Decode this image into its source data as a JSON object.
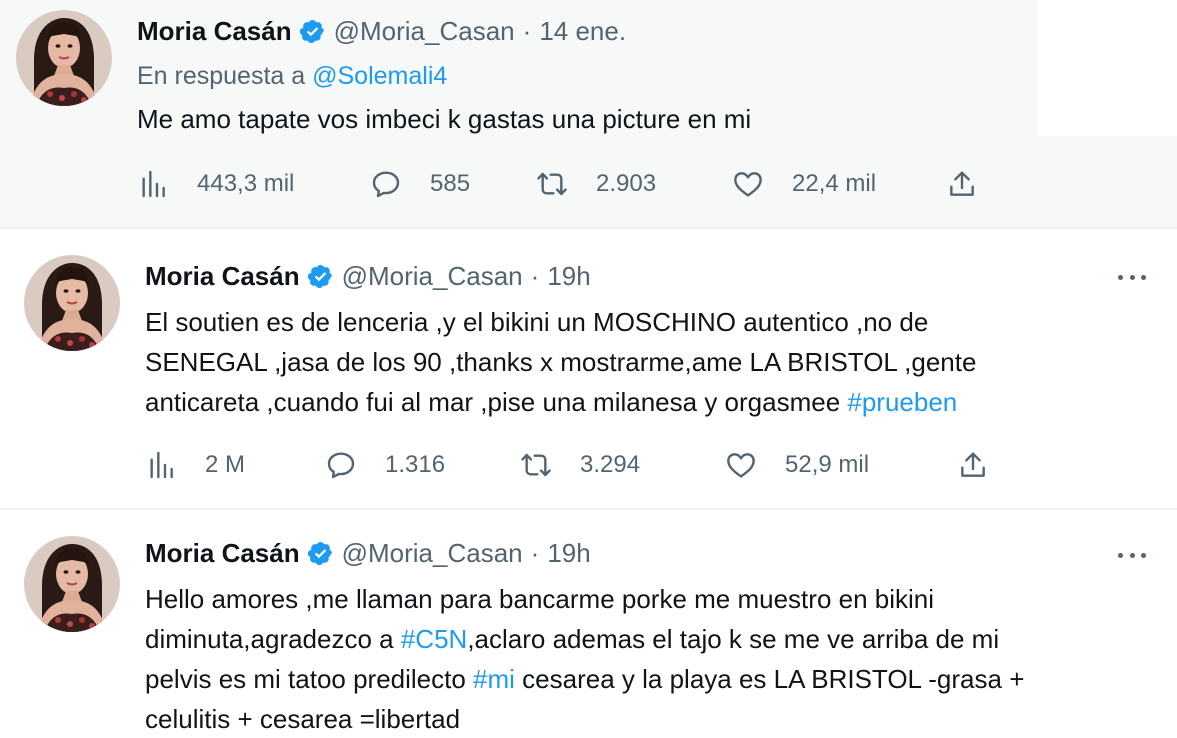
{
  "colors": {
    "accent": "#1d9bf0",
    "muted": "#536471",
    "text": "#0f1419"
  },
  "tweets": [
    {
      "name": "Moria Casán",
      "handle": "@Moria_Casan",
      "dot": "·",
      "time": "14 ene.",
      "reply_prefix": "En respuesta a",
      "reply_to": "@Solemali4",
      "lines": [
        [
          "Me amo tapate vos imbeci  k gastas una picture en mi"
        ]
      ],
      "stats": {
        "views": "443,3 mil",
        "replies": "585",
        "retweets": "2.903",
        "likes": "22,4 mil"
      }
    },
    {
      "name": "Moria Casán",
      "handle": "@Moria_Casan",
      "dot": "·",
      "time": "19h",
      "lines": [
        [
          "El soutien es de lenceria ,y el bikini un MOSCHINO autentico ,no de"
        ],
        [
          "SENEGAL ,jasa de los 90 ,thanks x mostrarme,ame LA BRISTOL ,gente"
        ],
        [
          "anticareta ,cuando fui al mar ,pise una milanesa y orgasmee ",
          "#prueben"
        ]
      ],
      "stats": {
        "views": "2 M",
        "replies": "1.316",
        "retweets": "3.294",
        "likes": "52,9 mil"
      }
    },
    {
      "name": "Moria Casán",
      "handle": "@Moria_Casan",
      "dot": "·",
      "time": "19h",
      "lines": [
        [
          "Hello amores ,me llaman para bancarme porke me muestro en bikini"
        ],
        [
          "diminuta,agradezco a ",
          "#C5N",
          ",aclaro ademas el tajo k se me ve arriba de mi"
        ],
        [
          "pelvis es mi tatoo predilecto ",
          "#mi",
          " cesarea y la playa es LA BRISTOL -grasa +"
        ],
        [
          "celulitis + cesarea =libertad"
        ]
      ]
    }
  ],
  "icons": {
    "verified": "verified-badge-icon",
    "views": "views-chart-icon",
    "reply": "reply-icon",
    "retweet": "retweet-icon",
    "like": "heart-icon",
    "share": "share-icon",
    "more": "more-icon"
  }
}
